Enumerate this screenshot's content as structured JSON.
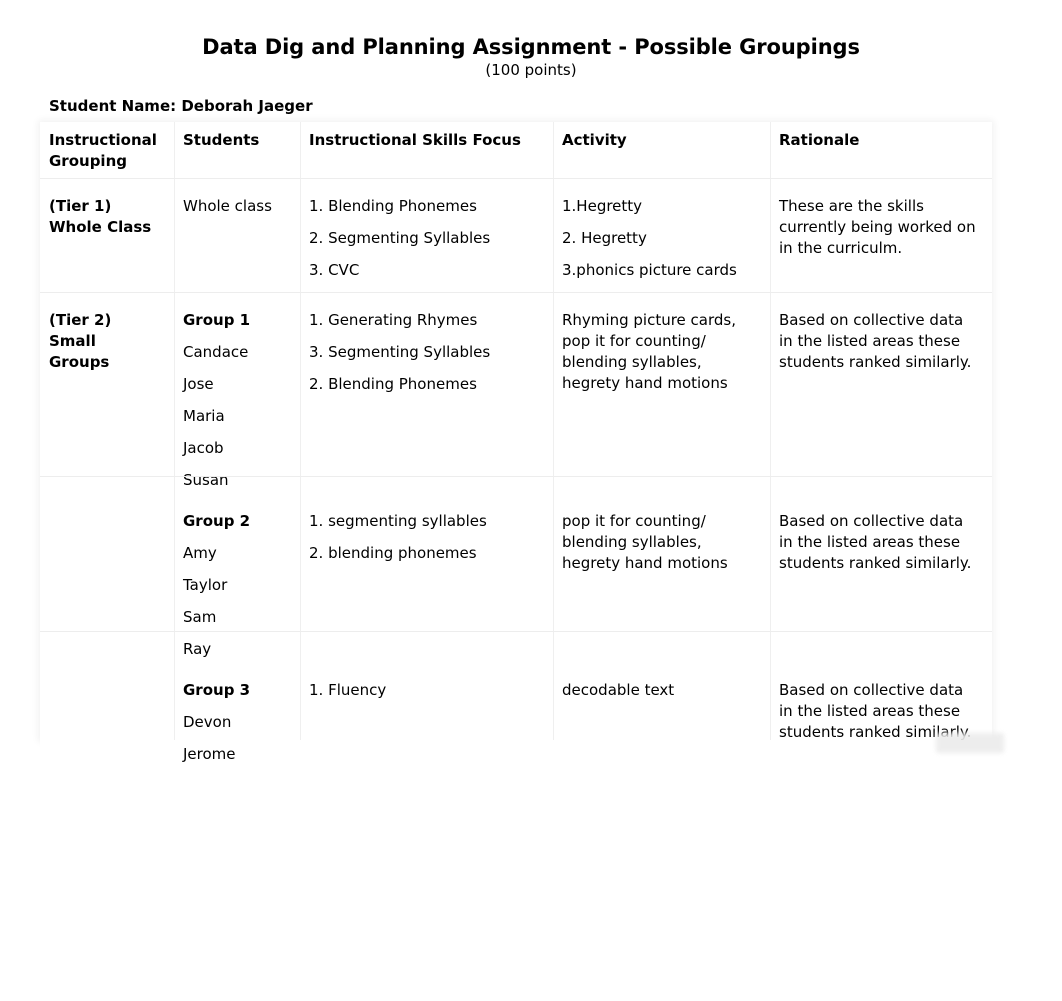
{
  "document": {
    "title": "Data Dig and Planning Assignment - Possible Groupings",
    "subtitle": "(100 points)",
    "student_name_line": "Student Name: Deborah Jaeger"
  },
  "table": {
    "headers": [
      "Instructional Grouping",
      "Students",
      "Instructional Skills Focus",
      "Activity",
      "Rationale"
    ],
    "tier1": {
      "grouping_line1": "(Tier 1)",
      "grouping_line2": "Whole Class",
      "students": "Whole class",
      "skills": [
        "1. Blending Phonemes",
        "2. Segmenting Syllables",
        "3. CVC"
      ],
      "activity": [
        "1.Hegretty",
        "2. Hegretty",
        "3.phonics picture cards"
      ],
      "rationale": "These are the skills currently being worked on in the curriculm."
    },
    "tier2": {
      "grouping_line1": "(Tier 2)",
      "grouping_line2": "Small",
      "grouping_line3": "Groups",
      "groups": [
        {
          "name": "Group 1",
          "students": [
            "Candace",
            "Jose",
            "Maria",
            "Jacob",
            "Susan"
          ],
          "skills": [
            "1. Generating Rhymes",
            "3. Segmenting Syllables",
            "2. Blending Phonemes"
          ],
          "activity": "Rhyming picture cards, pop it for counting/ blending syllables, hegrety hand motions",
          "rationale": "Based on collective data in the listed areas these students ranked similarly."
        },
        {
          "name": "Group 2",
          "students": [
            "Amy",
            "Taylor",
            "Sam",
            "Ray"
          ],
          "skills": [
            "1. segmenting syllables",
            "2. blending phonemes"
          ],
          "activity": "pop it for counting/ blending syllables, hegrety hand motions",
          "rationale": "Based on collective data in the listed areas these students ranked similarly."
        },
        {
          "name": "Group 3",
          "students": [
            "Devon",
            "Jerome"
          ],
          "skills": [
            "1. Fluency"
          ],
          "activity": "decodable text",
          "rationale": "Based on collective data in the listed areas these students ranked similarly."
        }
      ]
    }
  }
}
